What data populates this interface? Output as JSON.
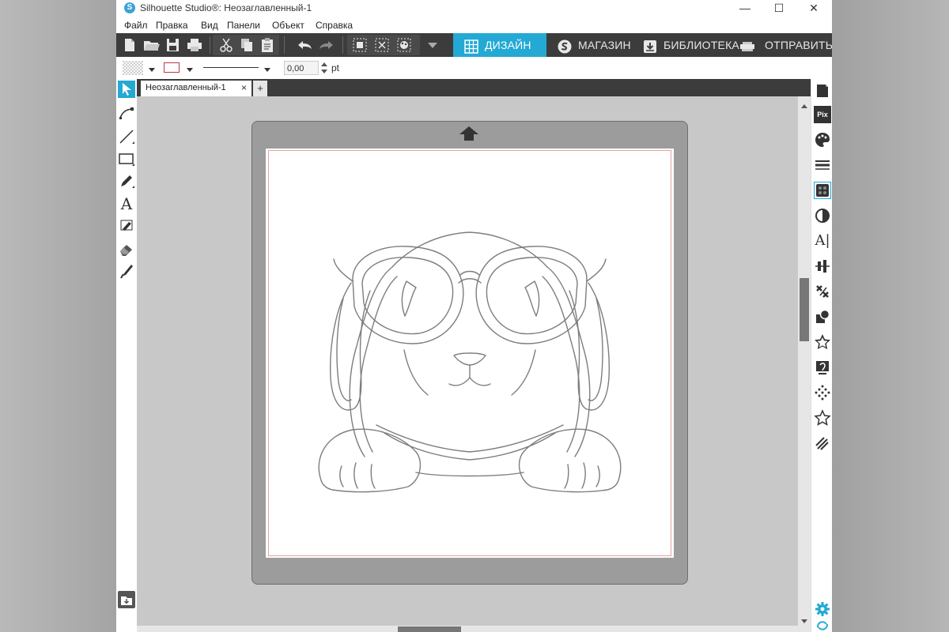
{
  "window": {
    "title": "Silhouette Studio®: Неозаглавленный-1",
    "controls": {
      "minimize": "—",
      "maximize": "☐",
      "close": "✕"
    }
  },
  "menu": [
    "Файл",
    "Правка",
    "Вид",
    "Панели",
    "Объект",
    "Справка"
  ],
  "nav_tabs": [
    {
      "label": "ДИЗАЙН",
      "icon": "grid-icon",
      "active": true
    },
    {
      "label": "МАГАЗИН",
      "icon": "silhouette-s-icon",
      "active": false
    },
    {
      "label": "БИБЛИОТЕКА",
      "icon": "download-box-icon",
      "active": false
    },
    {
      "label": "ОТПРАВИТЬ",
      "icon": "cutter-icon",
      "active": false
    }
  ],
  "options": {
    "line_width": "0,00",
    "unit": "pt"
  },
  "document": {
    "tab_label": "Неозаглавленный-1",
    "close_glyph": "×",
    "add_glyph": "+"
  },
  "right_panel": {
    "pix_label": "Pix",
    "text_label": "A|"
  },
  "left_tools": {
    "text_tool": "A"
  },
  "colors": {
    "accent": "#23a9d4",
    "toolbar": "#3c3c3c",
    "workspace": "#c8c8c8",
    "mat": "#9c9c9c",
    "cut_border": "#e3a3a3"
  }
}
